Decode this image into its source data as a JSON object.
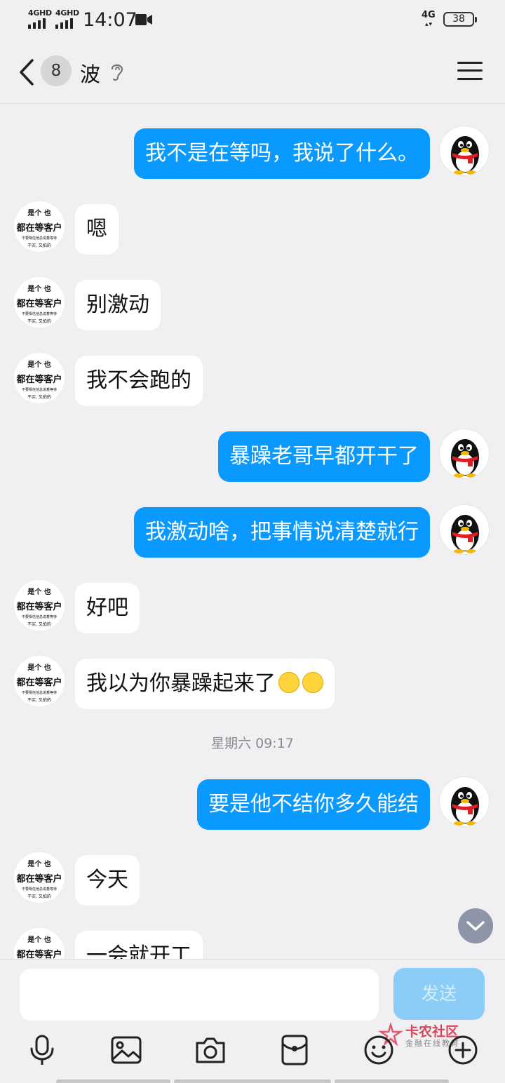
{
  "status_bar": {
    "net1": "4GHD",
    "net2": "4GHD",
    "time": "14:07",
    "net_right": "4G",
    "battery": "38"
  },
  "header": {
    "unread_count": "8",
    "title": "波"
  },
  "messages": [
    {
      "side": "out",
      "text": "我不是在等吗，我说了什么。"
    },
    {
      "side": "in",
      "text": "嗯"
    },
    {
      "side": "in",
      "text": "别激动"
    },
    {
      "side": "in",
      "text": "我不会跑的"
    },
    {
      "side": "out",
      "text": "暴躁老哥早都开干了"
    },
    {
      "side": "out",
      "text": "我激动啥，把事情说清楚就行"
    },
    {
      "side": "in",
      "text": "好吧"
    },
    {
      "side": "in",
      "text": "我以为你暴躁起来了"
    },
    {
      "side": "out",
      "text": "要是他不结你多久能结"
    },
    {
      "side": "in",
      "text": "今天"
    },
    {
      "side": "in",
      "text": "一会就开工"
    }
  ],
  "timestamp": "星期六 09:17",
  "contact_avatar_text": {
    "line1": "是个 也",
    "line2": "都在等客户",
    "line3": "不要相信他总说着等待",
    "line4": "不买, 又拍的"
  },
  "input": {
    "placeholder": "",
    "send_label": "发送"
  },
  "toolbar_icons": [
    "microphone-icon",
    "image-icon",
    "camera-icon",
    "red-packet-icon",
    "emoji-icon",
    "plus-icon"
  ],
  "watermark": {
    "title": "卡农社区",
    "subtitle": "金融在线教育"
  },
  "colors": {
    "outgoing_bubble": "#0a99ff",
    "incoming_bubble": "#ffffff",
    "background": "#f0f0f2",
    "send_button": "#8ccdf7"
  }
}
